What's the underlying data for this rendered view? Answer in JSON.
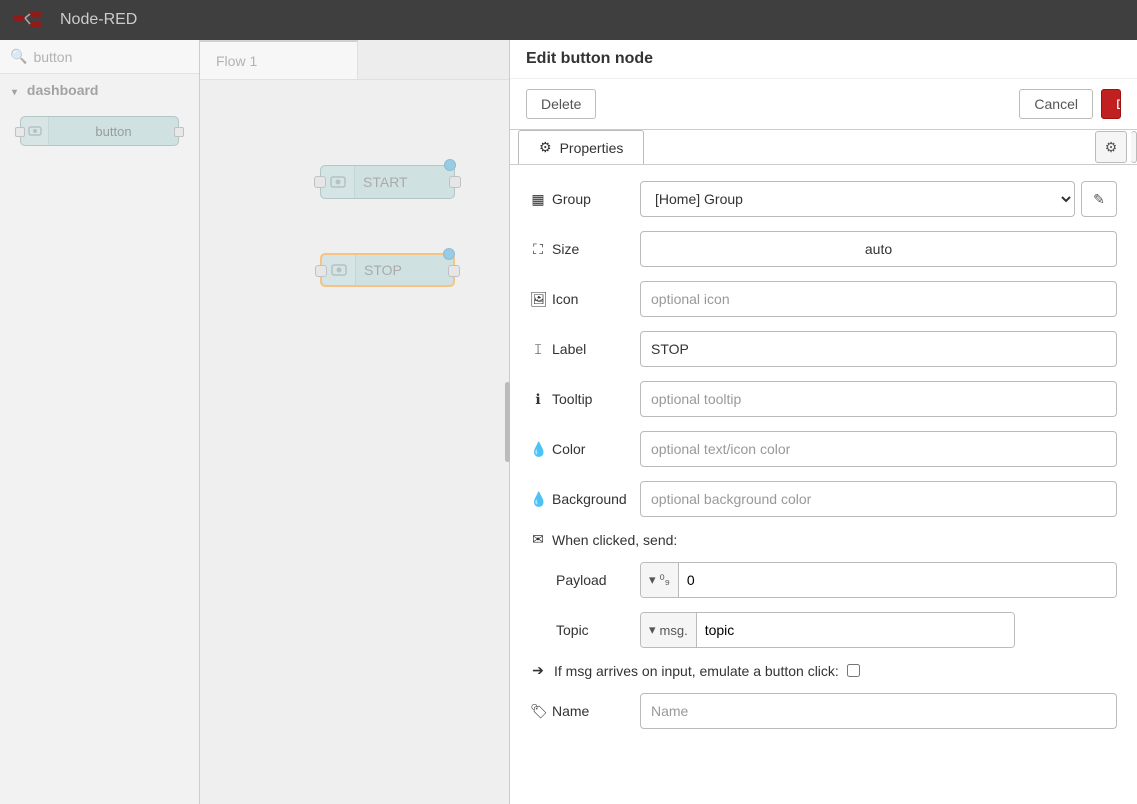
{
  "app_title": "Node-RED",
  "palette": {
    "search_value": "button",
    "category": "dashboard",
    "node_label": "button"
  },
  "workspace": {
    "tab_name": "Flow 1",
    "nodes": [
      {
        "label": "START"
      },
      {
        "label": "STOP"
      }
    ]
  },
  "editor": {
    "title": "Edit button node",
    "delete_label": "Delete",
    "cancel_label": "Cancel",
    "done_label": "Done",
    "properties_tab": "Properties",
    "fields": {
      "group_label": "Group",
      "group_value": "[Home] Group",
      "size_label": "Size",
      "size_value": "auto",
      "icon_label": "Icon",
      "icon_value": "",
      "icon_placeholder": "optional icon",
      "label_label": "Label",
      "label_value": "STOP",
      "tooltip_label": "Tooltip",
      "tooltip_value": "",
      "tooltip_placeholder": "optional tooltip",
      "color_label": "Color",
      "color_value": "",
      "color_placeholder": "optional text/icon color",
      "bg_label": "Background",
      "bg_value": "",
      "bg_placeholder": "optional background color",
      "section_heading": "When clicked, send:",
      "payload_label": "Payload",
      "payload_type_glyph": "⁰₉",
      "payload_value": "0",
      "topic_label": "Topic",
      "topic_type": "msg.",
      "topic_value": "topic",
      "emulate_label": "If msg arrives on input, emulate a button click:",
      "emulate_checked": false,
      "name_label": "Name",
      "name_value": "",
      "name_placeholder": "Name"
    }
  }
}
